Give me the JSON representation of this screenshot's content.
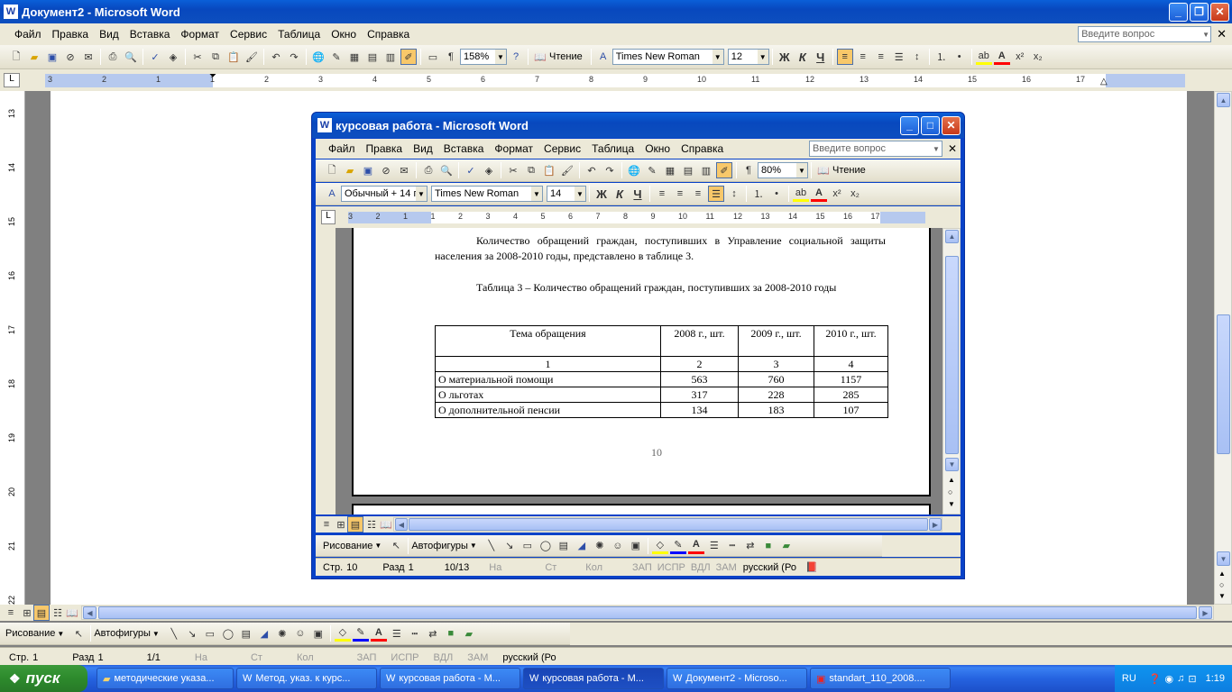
{
  "outer": {
    "title": "Документ2 - Microsoft Word",
    "menu": [
      "Файл",
      "Правка",
      "Вид",
      "Вставка",
      "Формат",
      "Сервис",
      "Таблица",
      "Окно",
      "Справка"
    ],
    "ask_placeholder": "Введите вопрос",
    "zoom": "158%",
    "reading": "Чтение",
    "font": "Times New Roman",
    "size": "12",
    "bold": "Ж",
    "italic": "К",
    "underline": "Ч",
    "ruler_numbers": [
      "3",
      "2",
      "1",
      "1",
      "2",
      "3",
      "4",
      "5",
      "6",
      "7",
      "8",
      "9",
      "10",
      "11",
      "12",
      "13",
      "14",
      "15",
      "16",
      "17"
    ],
    "vruler_numbers": [
      "13",
      "14",
      "15",
      "16",
      "17",
      "18",
      "19",
      "20",
      "21",
      "22"
    ],
    "drawing_label": "Рисование",
    "autoshapes_label": "Автофигуры",
    "status": {
      "page": "Стр.",
      "page_num": "1",
      "section": "Разд",
      "section_num": "1",
      "pages": "1/1",
      "at": "На",
      "line": "Ст",
      "col": "Кол",
      "rec": "ЗАП",
      "trk": "ИСПР",
      "ext": "ВДЛ",
      "ovr": "ЗАМ",
      "lang": "русский (Ро"
    }
  },
  "inner": {
    "title": "курсовая работа - Microsoft Word",
    "menu": [
      "Файл",
      "Правка",
      "Вид",
      "Вставка",
      "Формат",
      "Сервис",
      "Таблица",
      "Окно",
      "Справка"
    ],
    "ask_placeholder": "Введите вопрос",
    "zoom": "80%",
    "reading": "Чтение",
    "style": "Обычный + 14 г",
    "font": "Times New Roman",
    "size": "14",
    "bold": "Ж",
    "italic": "К",
    "underline": "Ч",
    "ruler_numbers": [
      "3",
      "2",
      "1",
      "1",
      "2",
      "3",
      "4",
      "5",
      "6",
      "7",
      "8",
      "9",
      "10",
      "11",
      "12",
      "13",
      "14",
      "15",
      "16",
      "17"
    ],
    "drawing_label": "Рисование",
    "autoshapes_label": "Автофигуры",
    "status": {
      "page": "Стр.",
      "page_num": "10",
      "section": "Разд",
      "section_num": "1",
      "pages": "10/13",
      "at": "На",
      "line": "Ст",
      "col": "Кол",
      "rec": "ЗАП",
      "trk": "ИСПР",
      "ext": "ВДЛ",
      "ovr": "ЗАМ",
      "lang": "русский (Ро"
    },
    "document": {
      "para1": "Количество обращений граждан, поступивших в Управление социальной защиты населения за 2008-2010 годы, представлено в таблице 3.",
      "caption": "Таблица 3 – Количество обращений граждан, поступивших за 2008-2010 годы",
      "table_header": [
        "Тема обращения",
        "2008 г., шт.",
        "2009 г., шт.",
        "2010 г., шт."
      ],
      "table_numbers": [
        "1",
        "2",
        "3",
        "4"
      ],
      "rows": [
        [
          "О материальной помощи",
          "563",
          "760",
          "1157"
        ],
        [
          "О льготах",
          "317",
          "228",
          "285"
        ],
        [
          "О дополнительной пенсии",
          "134",
          "183",
          "107"
        ]
      ],
      "page_number": "10"
    }
  },
  "taskbar": {
    "start": "пуск",
    "tasks": [
      "методические указа...",
      "Метод. указ. к курс...",
      "курсовая работа - М...",
      "курсовая работа - М...",
      "Документ2 - Microso...",
      "standart_110_2008...."
    ],
    "lang": "RU",
    "clock": "1:19"
  },
  "colors": {
    "xp_blue": "#0A5FD8",
    "face": "#ECE9D8",
    "start_green": "#3B9A3A"
  }
}
